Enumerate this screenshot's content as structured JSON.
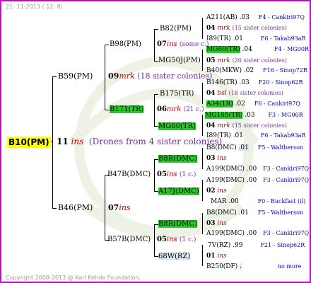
{
  "header": {
    "date": "21- 11-2013 ( 12:  8)"
  },
  "footer": {
    "copyright": "Copyright 2008-2013 @ Karl Kehde Foundation."
  },
  "colors": {
    "frame": "#d000d0",
    "root_bg": "#ffff00",
    "highlight": "#22cc22",
    "ins": "#d00000",
    "sister_note": "#7030a0",
    "source": "#0000c0"
  },
  "root": {
    "id": "B10(PM)",
    "num": "11",
    "ins": "ins",
    "note": "(Drones from 4 sister colonies)"
  },
  "n": {
    "b59": "B59(PM)",
    "b46": "B46(PM)",
    "b98": "B98(PM)",
    "b171": "B171(TR)",
    "b47": "B47B(DMC)",
    "b57": "B57B(DMC)",
    "b82": "B82(PM)",
    "mg50j": "MG50J(PM)",
    "b175": "B175(TR)",
    "mg60": "MG60(TR)",
    "b8ra": "B8R(DMC)",
    "a17j": "A17J(DMC)",
    "b8rb": "B8R(DMC)",
    "w68": "68W(RZ)"
  },
  "c": {
    "b59": {
      "num": "09",
      "ins": "mrk",
      "note": "(18 sister colonies)"
    },
    "b46": {
      "num": "07",
      "ins": "ins"
    },
    "b98": {
      "num": "07",
      "ins": "ins",
      "note": "(some c.)"
    },
    "b171": {
      "num": "06",
      "ins": "mrk",
      "note": "(21 c.)"
    },
    "b47": {
      "num": "05",
      "ins": "ins",
      "note": "(1 c.)"
    },
    "b57": {
      "num": "05",
      "ins": "ins",
      "note": "(1 c.)"
    }
  },
  "x": [
    {
      "num": "04",
      "ins": "mrk",
      "note": "(15 sister colonies)"
    },
    {
      "num": "05",
      "ins": "mrk",
      "note": "(20 sister colonies)"
    },
    {
      "num": "04",
      "ins": "bsl",
      "note": "(18 sister colonies)"
    },
    {
      "num": "04",
      "ins": "mrk",
      "note": "(15 sister colonies)"
    },
    {
      "num": "03",
      "ins": "ins"
    },
    {
      "num": "02",
      "ins": "ins"
    },
    {
      "num": "03",
      "ins": "ins"
    },
    {
      "num": "01",
      "ins": "ins"
    }
  ],
  "g": [
    {
      "id": "A211(AB)",
      "v": ".03",
      "src": "F4 - Cankiri97Q"
    },
    {
      "id": "I89(TR)",
      "v": ".01",
      "src": "F6 - Takab93aR"
    },
    {
      "id": "MG60(TR)",
      "v": ".04",
      "src": "F4 - MG00R"
    },
    {
      "id": "B40(MKW)",
      "v": ".02",
      "src": "F16 - Sinop72R"
    },
    {
      "id": "B146(TR)",
      "v": ".03",
      "src": "F20 - Sinop62R"
    },
    {
      "id": "A34(TR)",
      "v": ".02",
      "src": "F6 - Cankiri97Q"
    },
    {
      "id": "MG165(TR)",
      "v": ".03",
      "src": "F3 - MG00R"
    },
    {
      "id": "I89(TR)",
      "v": ".01",
      "src": "F6 - Takab93aR"
    },
    {
      "id": "B8(DMC)",
      "v": ".01",
      "src": "F5 - Waltherson"
    },
    {
      "id": "A199(DMC)",
      "v": ".00",
      "src": "F3 - Cankiri97Q"
    },
    {
      "id": "A199(DMC)",
      "v": ".00",
      "src": "F3 - Cankiri97Q"
    },
    {
      "id": "MAR",
      "v": ".00",
      "src": "F0 - Buckfast (il)"
    },
    {
      "id": "B8(DMC)",
      "v": ".01",
      "src": "F5 - Waltherson"
    },
    {
      "id": "A199(DMC)",
      "v": ".00",
      "src": "F3 - Cankiri97Q"
    },
    {
      "id": "7V(RZ)",
      "v": ".99",
      "src": "F21 - Sinop62R"
    },
    {
      "id": "B250(DF)",
      "v": ".",
      "src": "no more"
    }
  ]
}
